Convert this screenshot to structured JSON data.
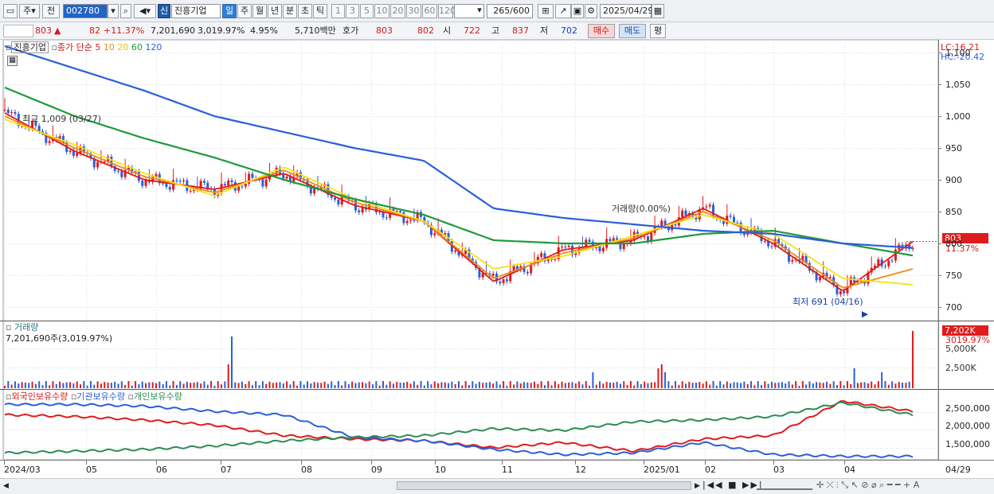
{
  "toolbar": {
    "market_type": "주",
    "prev_btn": "전",
    "stock_code": "002780",
    "credit_badge": "신",
    "stock_name": "진흥기업",
    "periods": [
      "일",
      "주",
      "월",
      "년",
      "분",
      "초",
      "틱"
    ],
    "active_period": "일",
    "intervals": [
      "1",
      "3",
      "5",
      "10",
      "20",
      "30",
      "60",
      "120"
    ],
    "count": "265",
    "count_total": "/600",
    "date": "2025/04/29"
  },
  "quote": {
    "price": "803",
    "change_arrow": "▲",
    "change": "82",
    "change_pct": "+11.37%",
    "volume": "7,201,690",
    "volume_pct": "3,019.97%",
    "turnover_pct": "4.95%",
    "amount": "5,710백만",
    "bid_label": "호가",
    "ask": "803",
    "bid": "802",
    "open_label": "시",
    "open": "722",
    "high_label": "고",
    "high": "837",
    "low_label": "저",
    "low": "702",
    "buy_btn": "매수",
    "sell_btn": "매도",
    "eval_btn": "평"
  },
  "price_panel": {
    "legend_name": "진흥기업",
    "legend_ma_label": "종가 단순",
    "ma_periods": [
      "5",
      "10",
      "20",
      "60",
      "120"
    ],
    "ma_colors": [
      "#e01b1b",
      "#f08a1c",
      "#f5e11a",
      "#1e9a3c",
      "#2b5fd9"
    ],
    "lc": "LC:16.21",
    "hc": "HC:-20.42",
    "high_note": "최고 1,009 (03/27)",
    "low_note": "최저 691 (04/16)",
    "mid_note": "거래량(0.00%)",
    "current_price": "803",
    "current_pct": "11.37%",
    "y_ticks": [
      "1,100",
      "1,050",
      "1,000",
      "950",
      "900",
      "850",
      "800",
      "750",
      "700"
    ]
  },
  "volume_panel": {
    "title": "거래량",
    "value": "7,201,690주(3,019.97%)",
    "current": "7,202K",
    "current_pct": "3019.97%",
    "y_ticks": [
      "5,000K",
      "2,500K"
    ]
  },
  "holder_panel": {
    "legends": [
      "외국인보유수량",
      "기관보유수량",
      "개인보유수량"
    ],
    "colors": [
      "#e01b1b",
      "#2b5fd9",
      "#2e8b57"
    ],
    "y_ticks": [
      "2,500,000",
      "2,000,000",
      "1,500,000"
    ]
  },
  "x_axis": {
    "labels": [
      "2024/03",
      "05",
      "06",
      "07",
      "08",
      "09",
      "10",
      "11",
      "12",
      "2025/01",
      "02",
      "03",
      "04"
    ],
    "end_label": "04/29"
  },
  "chart_data": {
    "type": "line",
    "title": "진흥기업",
    "x": [
      "2024/03",
      "05",
      "06",
      "07",
      "08",
      "09",
      "10",
      "11",
      "12",
      "2025/01",
      "02",
      "03",
      "04",
      "04/29"
    ],
    "series": [
      {
        "name": "5",
        "values": [
          1005,
          945,
          900,
          885,
          910,
          860,
          835,
          740,
          790,
          805,
          855,
          800,
          725,
          803
        ]
      },
      {
        "name": "10",
        "values": [
          1000,
          950,
          905,
          880,
          915,
          865,
          835,
          745,
          785,
          808,
          850,
          805,
          730,
          760
        ]
      },
      {
        "name": "20",
        "values": [
          995,
          955,
          910,
          875,
          920,
          870,
          835,
          760,
          780,
          812,
          845,
          815,
          745,
          735
        ]
      },
      {
        "name": "60",
        "values": [
          1045,
          1000,
          965,
          935,
          900,
          870,
          845,
          805,
          800,
          800,
          815,
          820,
          800,
          781
        ]
      },
      {
        "name": "120",
        "values": [
          1110,
          1075,
          1040,
          1000,
          975,
          950,
          930,
          855,
          840,
          830,
          820,
          815,
          800,
          793
        ]
      }
    ],
    "ylim": [
      680,
      1120
    ],
    "grid": true
  }
}
